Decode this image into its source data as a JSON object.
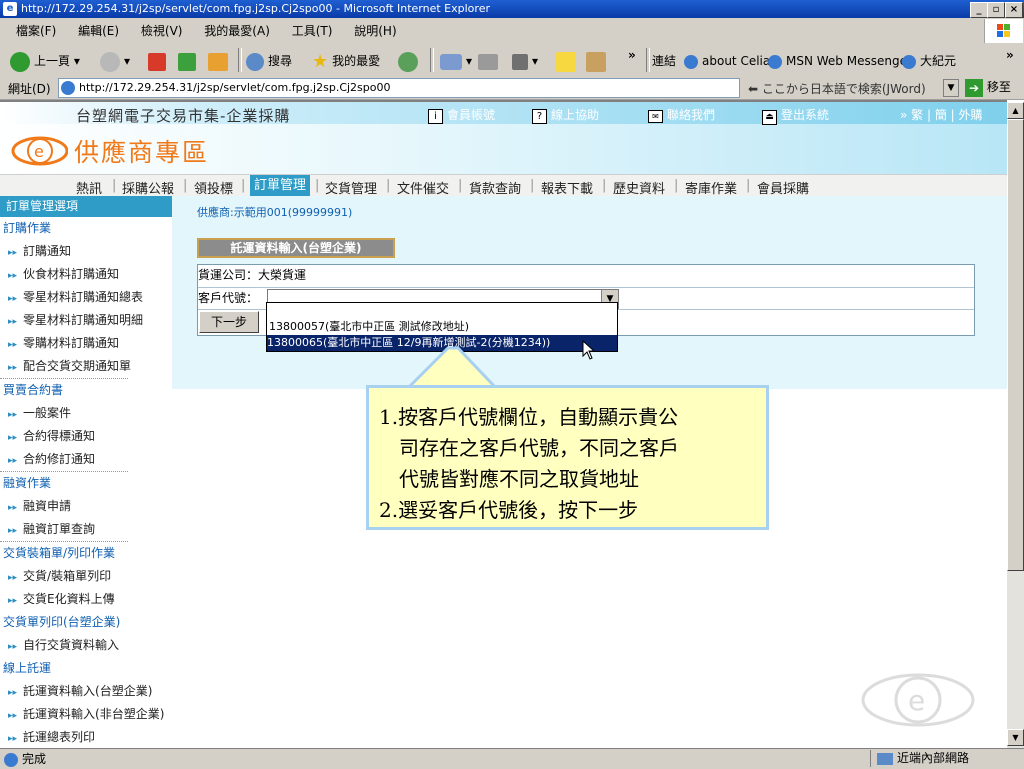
{
  "window": {
    "title": "http://172.29.254.31/j2sp/servlet/com.fpg.j2sp.Cj2spo00 - Microsoft Internet Explorer"
  },
  "menubar": {
    "items": [
      "檔案(F)",
      "編輯(E)",
      "檢視(V)",
      "我的最愛(A)",
      "工具(T)",
      "說明(H)"
    ]
  },
  "toolbar": {
    "back": "上一頁",
    "search": "搜尋",
    "favorites": "我的最愛",
    "links": "連結",
    "link1": "about Celia",
    "link2": "MSN Web Messenger",
    "link3": "大紀元",
    "chevron": "»"
  },
  "addressbar": {
    "label": "網址(D)",
    "url": "http://172.29.254.31/j2sp/servlet/com.fpg.j2sp.Cj2spo00",
    "jword": "ここから日本語で検索(JWord)",
    "go": "移至"
  },
  "header": {
    "site_title": "台塑網電子交易市集-企業採購",
    "zone_title": "供應商專區",
    "account": "會員帳號",
    "help": "線上協助",
    "contact": "聯絡我們",
    "logout": "登出系統",
    "lang": "» 繁 | 簡 | 外購"
  },
  "nav": {
    "items": [
      "熱訊",
      "採購公報",
      "領投標",
      "訂單管理",
      "交貨管理",
      "文件催交",
      "貨款查詢",
      "報表下載",
      "歷史資料",
      "寄庫作業",
      "會員採購"
    ]
  },
  "sidebar": {
    "header": "訂單管理選項",
    "sections": [
      {
        "title": "訂購作業",
        "items": [
          "訂購通知",
          "伙食材料訂購通知",
          "零星材料訂購通知總表",
          "零星材料訂購通知明細",
          "零購材料訂購通知",
          "配合交貨交期通知單"
        ]
      },
      {
        "title": "買賣合約書",
        "items": [
          "一般案件",
          "合約得標通知",
          "合約修訂通知"
        ]
      },
      {
        "title": "融資作業",
        "items": [
          "融資申請",
          "融資訂單查詢"
        ]
      },
      {
        "title": "交貨裝箱單/列印作業",
        "items": [
          "交貨/裝箱單列印",
          "交貨E化資料上傳"
        ]
      },
      {
        "title": "交貨單列印(台塑企業)",
        "items": [
          "自行交貨資料輸入"
        ]
      },
      {
        "title": "線上託運",
        "items": [
          "託運資料輸入(台塑企業)",
          "託運資料輸入(非台塑企業)",
          "託運總表列印"
        ]
      }
    ]
  },
  "main": {
    "supplier": "供應商:示範用001(99999991)",
    "form_title": "託運資料輸入(台塑企業)",
    "carrier_label": "貨運公司：",
    "carrier_value": "大榮貨運",
    "customer_label": "客戶代號：",
    "customer_value": "",
    "next_button": "下一步",
    "dropdown_options": [
      "13800057(臺北市中正區    測試修改地址)",
      "13800065(臺北市中正區    12/9再新增測試-2(分機1234))"
    ],
    "selected_index": 1
  },
  "callout": {
    "lines": [
      "1.按客戶代號欄位，自動顯示貴公",
      "司存在之客戶代號，不同之客戶",
      "代號皆對應不同之取貨地址",
      "2.選妥客戶代號後，按下一步"
    ]
  },
  "status": {
    "left": "完成",
    "right": "近端內部網路"
  },
  "colors": {
    "accent": "#2e9cc6",
    "orange": "#f07a1a",
    "selection": "#0a246a",
    "callout_bg": "#ffffc0"
  }
}
